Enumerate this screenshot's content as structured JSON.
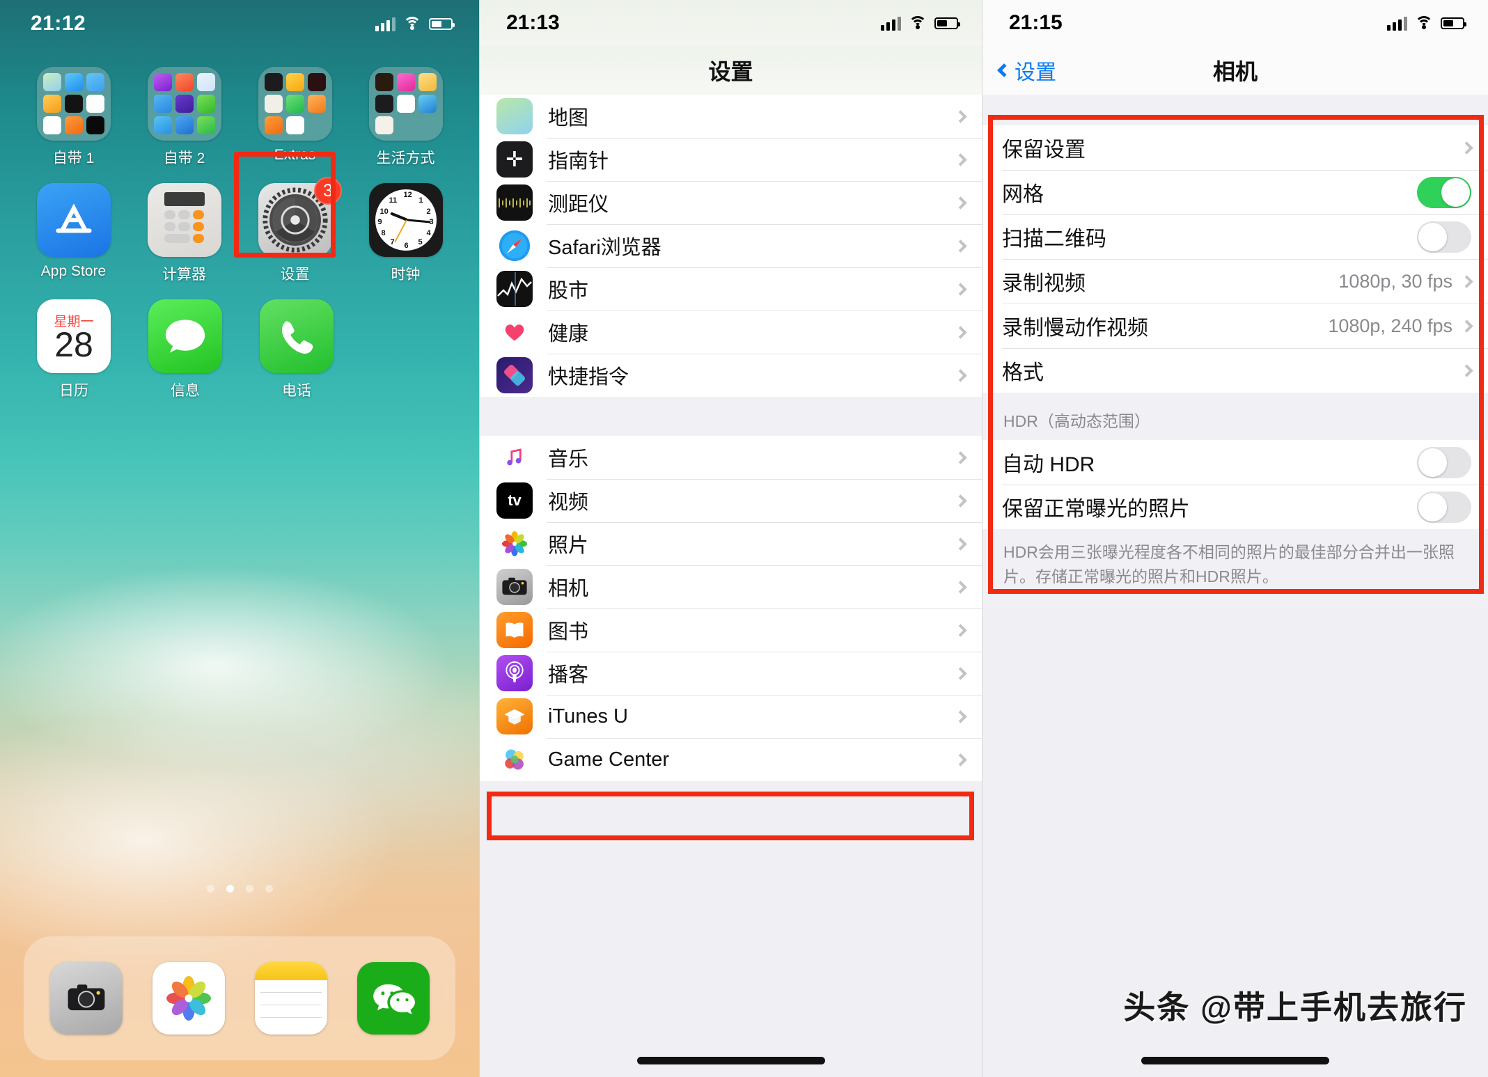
{
  "home": {
    "status": {
      "time": "21:12",
      "signal_icon": "signal-bars-icon",
      "wifi_icon": "wifi-icon",
      "battery_icon": "battery-icon"
    },
    "folders": [
      {
        "label": "自带 1"
      },
      {
        "label": "自带 2"
      },
      {
        "label": "Extras"
      },
      {
        "label": "生活方式"
      }
    ],
    "apps_row2": [
      {
        "label": "App Store",
        "badge": ""
      },
      {
        "label": "计算器",
        "badge": ""
      },
      {
        "label": "设置",
        "badge": "3",
        "highlighted": true
      },
      {
        "label": "时钟",
        "badge": ""
      }
    ],
    "apps_row3": [
      {
        "label": "日历",
        "weekday": "星期一",
        "day": "28"
      },
      {
        "label": "信息"
      },
      {
        "label": "电话"
      }
    ],
    "page_dots": {
      "count": 4,
      "active_index": 1
    },
    "dock": [
      {
        "label": "相机"
      },
      {
        "label": "照片"
      },
      {
        "label": "备忘录"
      },
      {
        "label": "微信"
      }
    ]
  },
  "settings": {
    "status": {
      "time": "21:13"
    },
    "nav": {
      "title": "设置"
    },
    "group1": [
      {
        "label": "地图",
        "icon": "maps-icon"
      },
      {
        "label": "指南针",
        "icon": "compass-icon"
      },
      {
        "label": "测距仪",
        "icon": "measure-icon"
      },
      {
        "label": "Safari浏览器",
        "icon": "safari-icon"
      },
      {
        "label": "股市",
        "icon": "stocks-icon"
      },
      {
        "label": "健康",
        "icon": "health-icon"
      },
      {
        "label": "快捷指令",
        "icon": "shortcuts-icon"
      }
    ],
    "group2": [
      {
        "label": "音乐",
        "icon": "music-icon"
      },
      {
        "label": "视频",
        "icon": "tv-icon"
      },
      {
        "label": "照片",
        "icon": "photos-icon"
      },
      {
        "label": "相机",
        "icon": "camera-icon",
        "highlighted": true
      },
      {
        "label": "图书",
        "icon": "books-icon"
      },
      {
        "label": "播客",
        "icon": "podcasts-icon"
      },
      {
        "label": "iTunes U",
        "icon": "itunes-u-icon"
      },
      {
        "label": "Game Center",
        "icon": "game-center-icon"
      }
    ]
  },
  "camera": {
    "status": {
      "time": "21:15"
    },
    "nav": {
      "back_label": "设置",
      "title": "相机"
    },
    "rows": [
      {
        "label": "保留设置",
        "type": "disclosure"
      },
      {
        "label": "网格",
        "type": "toggle",
        "state": "on"
      },
      {
        "label": "扫描二维码",
        "type": "toggle",
        "state": "off"
      },
      {
        "label": "录制视频",
        "type": "value",
        "value": "1080p, 30 fps"
      },
      {
        "label": "录制慢动作视频",
        "type": "value",
        "value": "1080p, 240 fps"
      },
      {
        "label": "格式",
        "type": "disclosure"
      }
    ],
    "hdr_header": "HDR（高动态范围）",
    "hdr_rows": [
      {
        "label": "自动 HDR",
        "type": "toggle",
        "state": "off"
      },
      {
        "label": "保留正常曝光的照片",
        "type": "toggle",
        "state": "off"
      }
    ],
    "hdr_footer": "HDR会用三张曝光程度各不相同的照片的最佳部分合并出一张照片。存储正常曝光的照片和HDR照片。",
    "watermark": "头条 @带上手机去旅行",
    "colors": {
      "accent": "#0a7bf5",
      "toggle_on": "#30d158",
      "highlight": "#f22a13"
    }
  }
}
